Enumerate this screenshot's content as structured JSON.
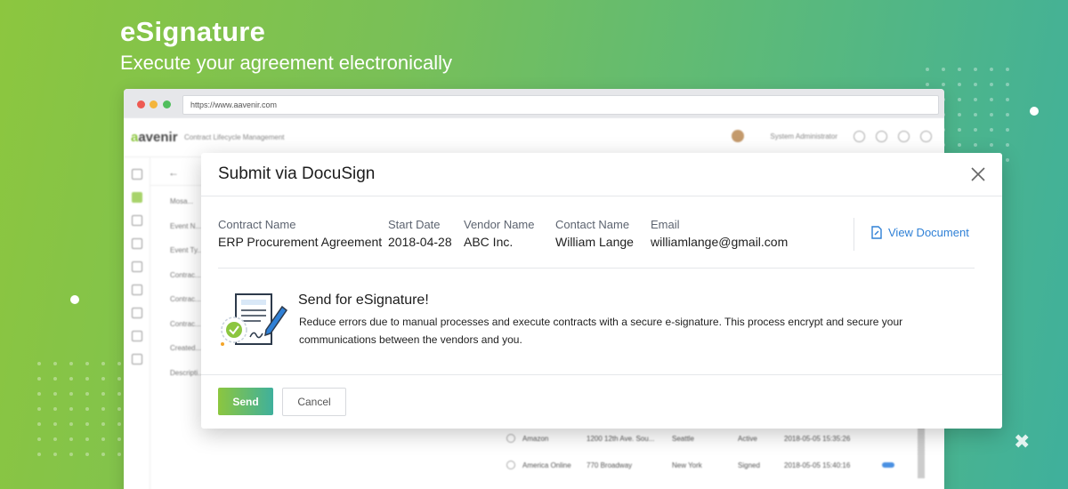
{
  "hero": {
    "title": "eSignature",
    "subtitle": "Execute your agreement electronically"
  },
  "browser": {
    "url": "https://www.aavenir.com"
  },
  "app": {
    "logo_prefix": "a",
    "logo_rest": "avenir",
    "name": "Contract Lifecycle Management",
    "user": "System Administrator",
    "form_labels": [
      "Mosa...",
      "Event N...",
      "Event Ty...",
      "Contrac...",
      "Contrac...",
      "Contrac...",
      "Created...",
      "Descripti..."
    ],
    "table_rows": [
      {
        "vendor": "Amazon",
        "address": "1200 12th Ave. Sou...",
        "city": "Seattle",
        "status": "Active",
        "date": "2018-05-05 15:35:26"
      },
      {
        "vendor": "America Online",
        "address": "770 Broadway",
        "city": "New York",
        "status": "Signed",
        "date": "2018-05-05 15:40:16"
      }
    ]
  },
  "modal": {
    "title": "Submit via DocuSign",
    "fields": [
      {
        "label": "Contract Name",
        "value": "ERP Procurement Agreement"
      },
      {
        "label": "Start Date",
        "value": "2018-04-28"
      },
      {
        "label": "Vendor Name",
        "value": "ABC Inc."
      },
      {
        "label": "Contact Name",
        "value": "William Lange"
      },
      {
        "label": "Email",
        "value": "williamlange@gmail.com"
      }
    ],
    "view_document": "View Document",
    "esign_title": "Send for eSignature!",
    "esign_description": "Reduce errors due to manual processes and execute contracts with a secure e-signature. This process encrypt and secure your communications between the vendors and you.",
    "send_label": "Send",
    "cancel_label": "Cancel"
  },
  "colors": {
    "accent_green": "#8cc63f",
    "accent_teal": "#3fb09c",
    "link_blue": "#2f80d6"
  },
  "icons": [
    "close-icon",
    "document-edit-icon",
    "signature-document-icon",
    "check-badge-icon"
  ]
}
